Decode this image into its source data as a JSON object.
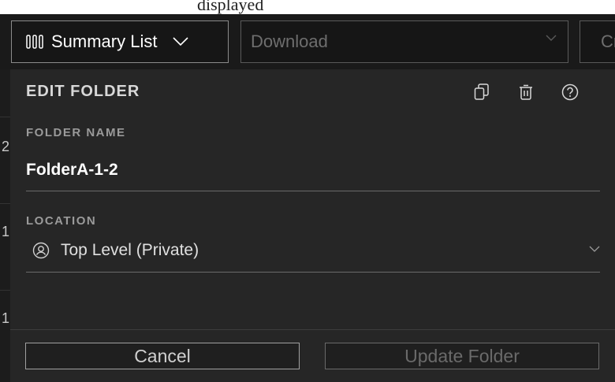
{
  "caption": {
    "text": "displayed"
  },
  "toolbar": {
    "summary_label": "Summary List",
    "download_placeholder": "Download",
    "partial_button_label": "Cr"
  },
  "background": {
    "row_digits": [
      "2",
      "1",
      "1"
    ]
  },
  "panel": {
    "title": "EDIT FOLDER",
    "icons": [
      "copy-icon",
      "trash-icon",
      "help-icon"
    ],
    "folder_name_label": "FOLDER NAME",
    "folder_name_value": "FolderA-1-2",
    "location_label": "LOCATION",
    "location_value": "Top Level (Private)",
    "cancel_label": "Cancel",
    "update_label": "Update Folder"
  },
  "colors": {
    "background": "#1a1a1a",
    "panel": "#262626",
    "text_primary": "#ffffff",
    "text_muted": "#9a9a9a",
    "disabled": "#6a6a6a"
  }
}
